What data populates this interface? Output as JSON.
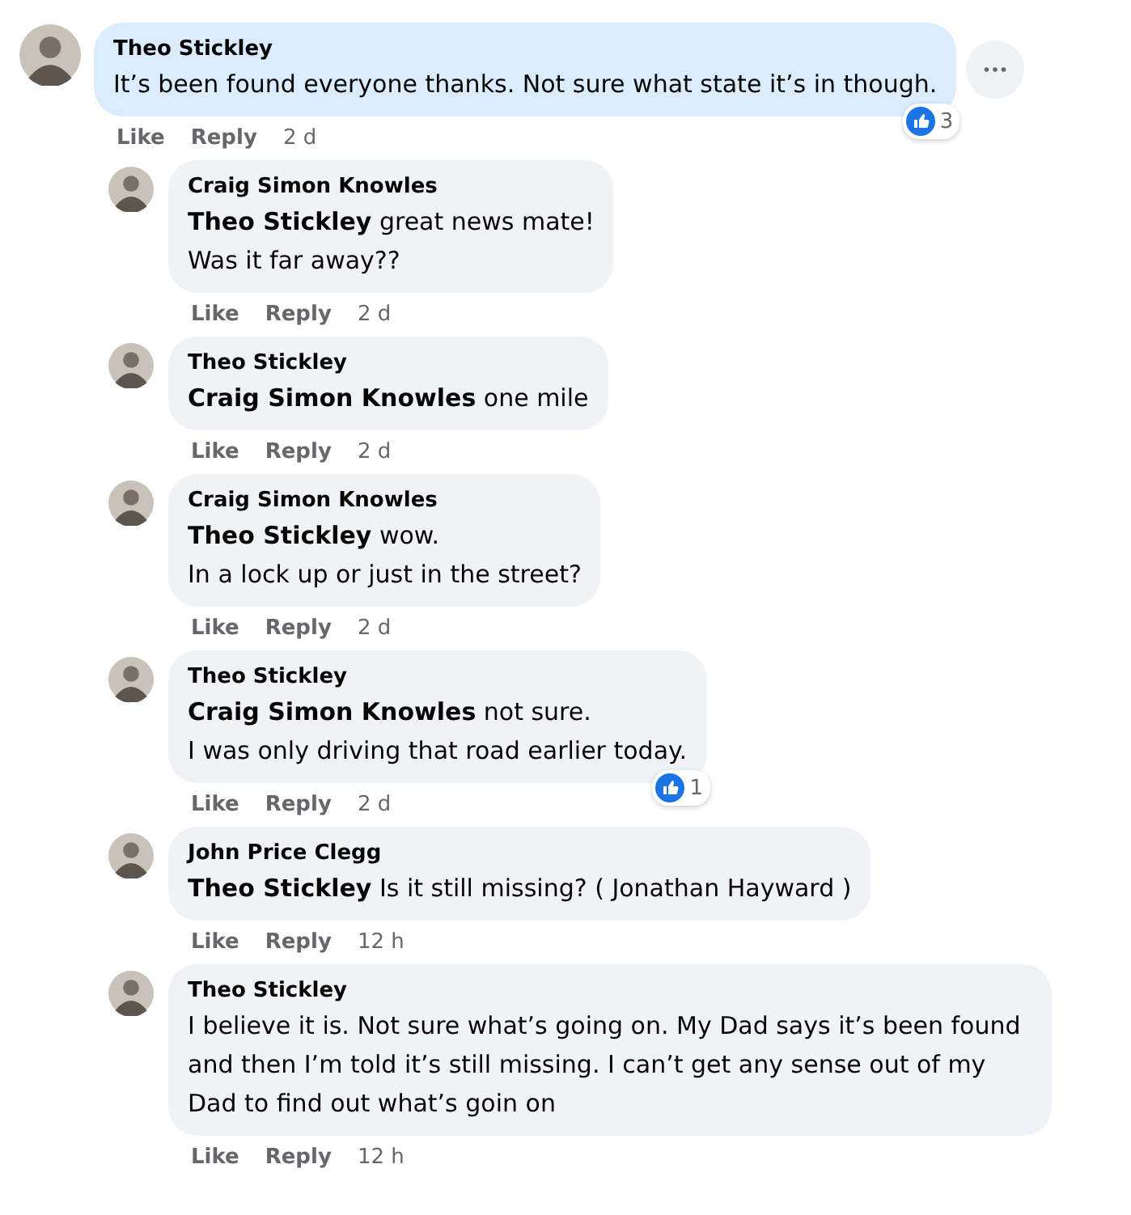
{
  "comments": [
    {
      "author": "Theo Stickley",
      "text": "It’s been found everyone thanks. Not sure what state it’s in though.",
      "highlighted": true,
      "reactions": "3",
      "actions": [
        "Like",
        "Reply"
      ],
      "time": "2 d",
      "children": [
        {
          "author": "Craig Simon Knowles",
          "text": "**Theo Stickley** great news mate!\nWas it far away??",
          "highlighted": false,
          "actions": [
            "Like",
            "Reply"
          ],
          "time": "2 d"
        },
        {
          "author": "Theo Stickley",
          "text": "**Craig Simon Knowles** one mile",
          "highlighted": false,
          "actions": [
            "Like",
            "Reply"
          ],
          "time": "2 d"
        },
        {
          "author": "Craig Simon Knowles",
          "text": "**Theo Stickley** wow.\nIn a lock up or just in the street?",
          "highlighted": false,
          "actions": [
            "Like",
            "Reply"
          ],
          "time": "2 d"
        },
        {
          "author": "Theo Stickley",
          "text": "**Craig Simon Knowles** not sure.\nI was only driving that road earlier today.",
          "highlighted": false,
          "reactions": "1",
          "actions": [
            "Like",
            "Reply"
          ],
          "time": "2 d"
        },
        {
          "author": "John Price Clegg",
          "text": "**Theo Stickley** Is it still missing? ( Jonathan Hayward )",
          "highlighted": false,
          "actions": [
            "Like",
            "Reply"
          ],
          "time": "12 h"
        },
        {
          "author": "Theo Stickley",
          "text": "I believe it is. Not sure what’s going on. My Dad says it’s been found and then I’m told it’s still missing. I can’t get any sense out of my Dad to find out what’s goin on",
          "highlighted": false,
          "actions": [
            "Like",
            "Reply"
          ],
          "time": "12 h"
        }
      ]
    }
  ]
}
